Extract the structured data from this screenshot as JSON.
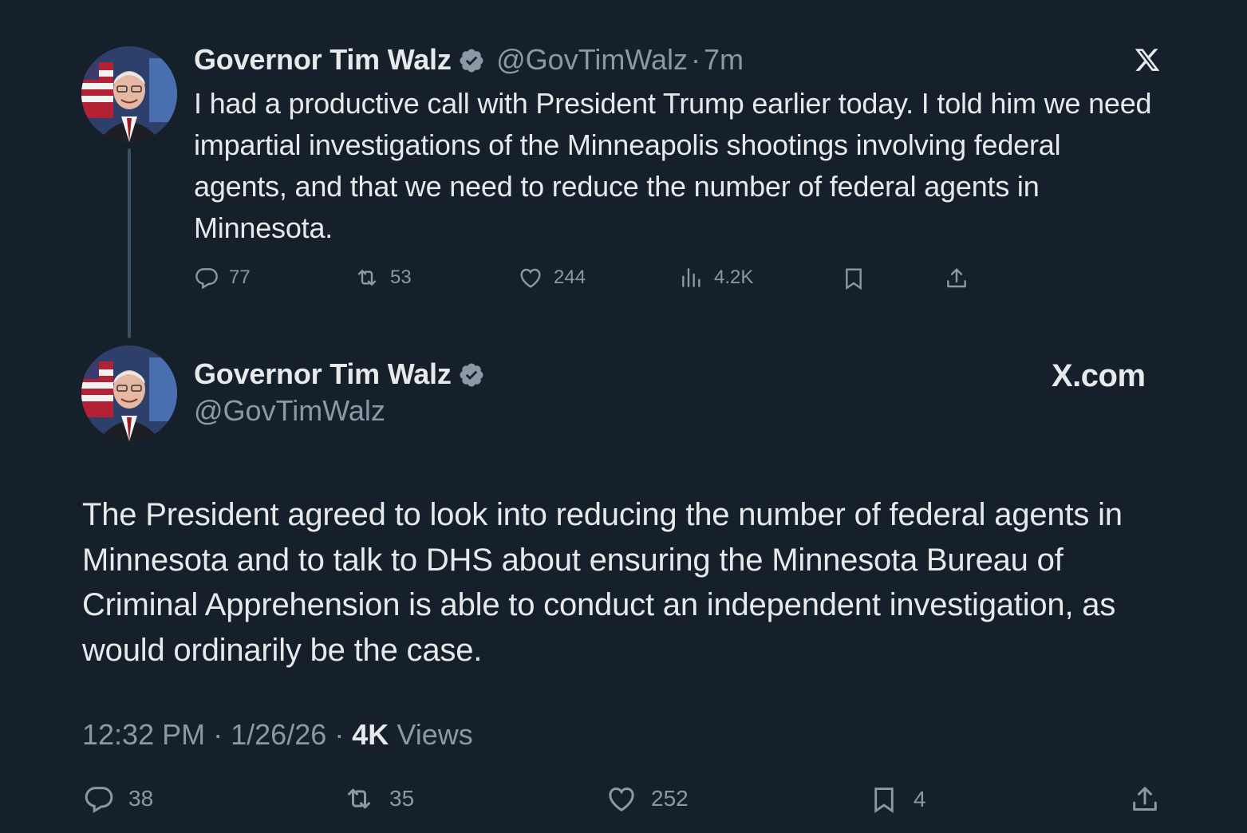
{
  "tweet1": {
    "author": {
      "name": "Governor Tim Walz",
      "handle": "@GovTimWalz",
      "verified": true
    },
    "separator": "·",
    "time_ago": "7m",
    "text": "I had a productive call with President Trump earlier today. I told him we need impartial investigations of the Minneapolis shootings involving federal agents, and that we need to reduce the number of federal agents in Minnesota.",
    "actions": {
      "replies": "77",
      "reposts": "53",
      "likes": "244",
      "views": "4.2K"
    },
    "brand_icon": "x-logo-icon"
  },
  "tweet2": {
    "author": {
      "name": "Governor Tim Walz",
      "handle": "@GovTimWalz",
      "verified": true
    },
    "brand_text": "X.com",
    "text": "The President agreed to look into reducing the number of federal agents in Minnesota and to talk to DHS about ensuring the Minnesota Bureau of Criminal Apprehension is able to conduct an independent investigation, as would ordinarily be the case.",
    "meta": {
      "time": "12:32 PM",
      "date": "1/26/26",
      "sep": "·",
      "views_count": "4K",
      "views_label": "Views"
    },
    "actions": {
      "replies": "38",
      "reposts": "35",
      "likes": "252",
      "bookmarks": "4"
    }
  },
  "colors": {
    "background": "#15202b",
    "text": "#e7e9ea",
    "secondary": "#8b98a5",
    "verified_badge": "#8b98a5"
  }
}
